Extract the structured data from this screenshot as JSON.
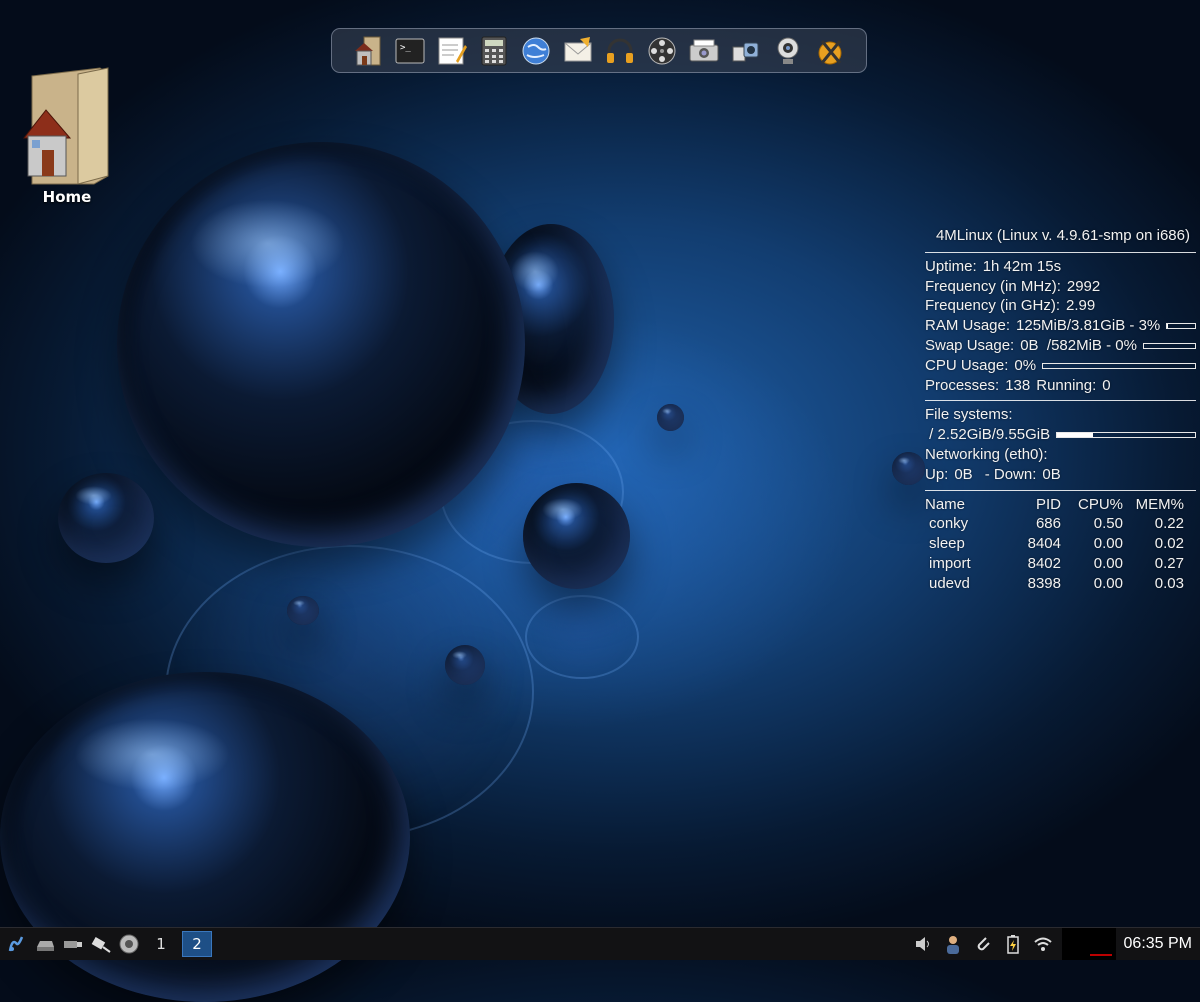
{
  "desktop": {
    "home_label": "Home"
  },
  "dock": {
    "items": [
      "home-folder-icon",
      "terminal-icon",
      "text-editor-icon",
      "calculator-icon",
      "web-browser-icon",
      "mail-icon",
      "headphones-icon",
      "film-reel-icon",
      "scanner-icon",
      "video-camera-icon",
      "webcam-icon",
      "x-settings-icon"
    ]
  },
  "conky": {
    "title": "4MLinux (Linux v. 4.9.61-smp on i686)",
    "uptime_label": "Uptime:",
    "uptime_value": "1h 42m 15s",
    "freq_mhz_label": "Frequency (in MHz):",
    "freq_mhz_value": "2992",
    "freq_ghz_label": "Frequency (in GHz):",
    "freq_ghz_value": "2.99",
    "ram_label": "RAM Usage:",
    "ram_value": "125MiB/3.81GiB - 3%",
    "ram_percent": 3,
    "swap_label": "Swap Usage:",
    "swap_value": "0B  /582MiB - 0%",
    "swap_percent": 0,
    "cpu_label": "CPU Usage:",
    "cpu_value": "0%",
    "cpu_percent": 0,
    "processes_label": "Processes:",
    "processes_value": "138",
    "running_label": "Running:",
    "running_value": "0",
    "fs_label": "File systems:",
    "fs_value": " / 2.52GiB/9.55GiB",
    "fs_percent": 26,
    "net_label": "Networking (eth0):",
    "up_label": "Up:",
    "up_value": "0B",
    "down_label": "- Down:",
    "down_value": "0B",
    "table_headers": {
      "name": "Name",
      "pid": "PID",
      "cpu": "CPU%",
      "mem": "MEM%"
    },
    "processes": [
      {
        "name": "conky",
        "pid": "686",
        "cpu": "0.50",
        "mem": "0.22"
      },
      {
        "name": "sleep",
        "pid": "8404",
        "cpu": "0.00",
        "mem": "0.02"
      },
      {
        "name": "import",
        "pid": "8402",
        "cpu": "0.00",
        "mem": "0.27"
      },
      {
        "name": "udevd",
        "pid": "8398",
        "cpu": "0.00",
        "mem": "0.03"
      }
    ]
  },
  "taskbar": {
    "launchers": [
      "menu-icon",
      "drive-icon",
      "usb-icon",
      "network-cable-icon",
      "speaker-icon"
    ],
    "workspaces": [
      "1",
      "2"
    ],
    "active_workspace": "2",
    "tray": [
      "volume-icon",
      "user-icon",
      "paperclip-icon",
      "battery-icon",
      "wifi-icon"
    ],
    "clock": "06:35 PM"
  }
}
